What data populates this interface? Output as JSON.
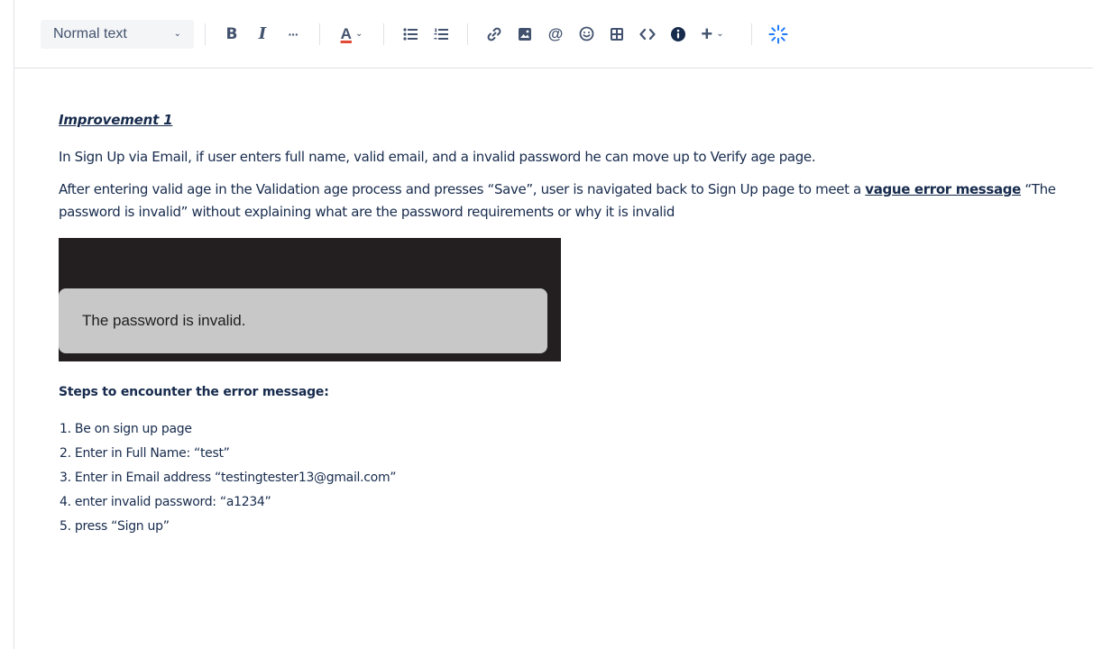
{
  "toolbar": {
    "text_style": "Normal text",
    "icons": {
      "bold": "bold-icon",
      "italic": "italic-icon",
      "more": "more-formatting-icon",
      "text_color": "text-color-icon",
      "bullet_list": "bullet-list-icon",
      "numbered_list": "numbered-list-icon",
      "link": "link-icon",
      "image": "image-icon",
      "mention": "mention-icon",
      "emoji": "emoji-icon",
      "table": "table-icon",
      "code": "code-icon",
      "info": "info-icon",
      "insert": "insert-icon",
      "ai": "sparkle-icon"
    },
    "glyphs": {
      "bold": "B",
      "italic": "I",
      "more": "···",
      "text_color": "A",
      "mention": "@",
      "insert": "+",
      "chevron": "⌄"
    },
    "colors": {
      "accent_blue": "#1d7afc",
      "text_color_bar": "#e34935"
    }
  },
  "document": {
    "heading": "Improvement 1",
    "para1": "In Sign Up via Email, if user enters full name, valid email, and a invalid password he can move up to Verify age page.",
    "para2_prefix": "After entering valid age in the Validation age process and presses  “Save”, user is navigated back to Sign Up page to meet a ",
    "para2_bold": "vague error message",
    "para2_suffix": " “The password is invalid” without explaining what are the password requirements or why it is invalid",
    "screenshot_toast": "The password is invalid.",
    "steps_title": "Steps to encounter the error message:",
    "steps": [
      "1. Be on sign up page",
      "2. Enter in Full Name: “test”",
      "3. Enter in Email address “testingtester13@gmail.com”",
      "4. enter invalid password: “a1234”",
      "5. press “Sign up”"
    ]
  }
}
